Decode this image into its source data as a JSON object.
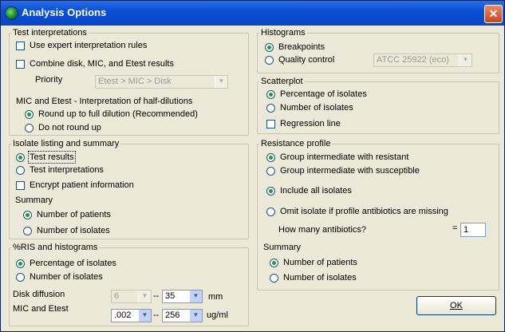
{
  "window": {
    "title": "Analysis Options",
    "close_glyph": "✕"
  },
  "test_interpretations": {
    "legend": "Test interpretations",
    "expert": "Use expert interpretation rules",
    "combine": "Combine disk, MIC, and Etest results",
    "priority_label": "Priority",
    "priority_value": "Etest > MIC > Disk",
    "half_dilutions_label": "MIC and Etest - Interpretation of half-dilutions",
    "round_up": "Round up to full dilution (Recommended)",
    "no_round": "Do not round up"
  },
  "isolate_listing": {
    "legend": "Isolate listing and summary",
    "test_results": "Test results",
    "test_interpretations": "Test interpretations",
    "encrypt": "Encrypt patient information",
    "summary_label": "Summary",
    "num_patients": "Number of patients",
    "num_isolates": "Number of isolates"
  },
  "ris": {
    "legend": "%RIS and histograms",
    "pct_isolates": "Percentage of isolates",
    "num_isolates": "Number of isolates",
    "disk_label": "Disk diffusion",
    "disk_from": "6",
    "disk_sep": "--",
    "disk_to": "35",
    "disk_unit": "mm",
    "mic_label": "MIC and Etest",
    "mic_from": ".002",
    "mic_sep": "--",
    "mic_to": "256",
    "mic_unit": "ug/ml"
  },
  "histograms": {
    "legend": "Histograms",
    "breakpoints": "Breakpoints",
    "quality_control": "Quality control",
    "qc_strain": "ATCC 25922  (eco)"
  },
  "scatterplot": {
    "legend": "Scatterplot",
    "pct_isolates": "Percentage of isolates",
    "num_isolates": "Number of isolates",
    "regression": "Regression line"
  },
  "resistance_profile": {
    "legend": "Resistance profile",
    "group_resistant": "Group intermediate with resistant",
    "group_susceptible": "Group intermediate with susceptible",
    "include_all": "Include all isolates",
    "omit": "Omit isolate if profile antibiotics are missing",
    "how_many_label": "How many antibiotics?",
    "eq": "=",
    "how_many_value": "1",
    "summary_label": "Summary",
    "num_patients": "Number of patients",
    "num_isolates": "Number of isolates"
  },
  "buttons": {
    "ok": "OK"
  }
}
